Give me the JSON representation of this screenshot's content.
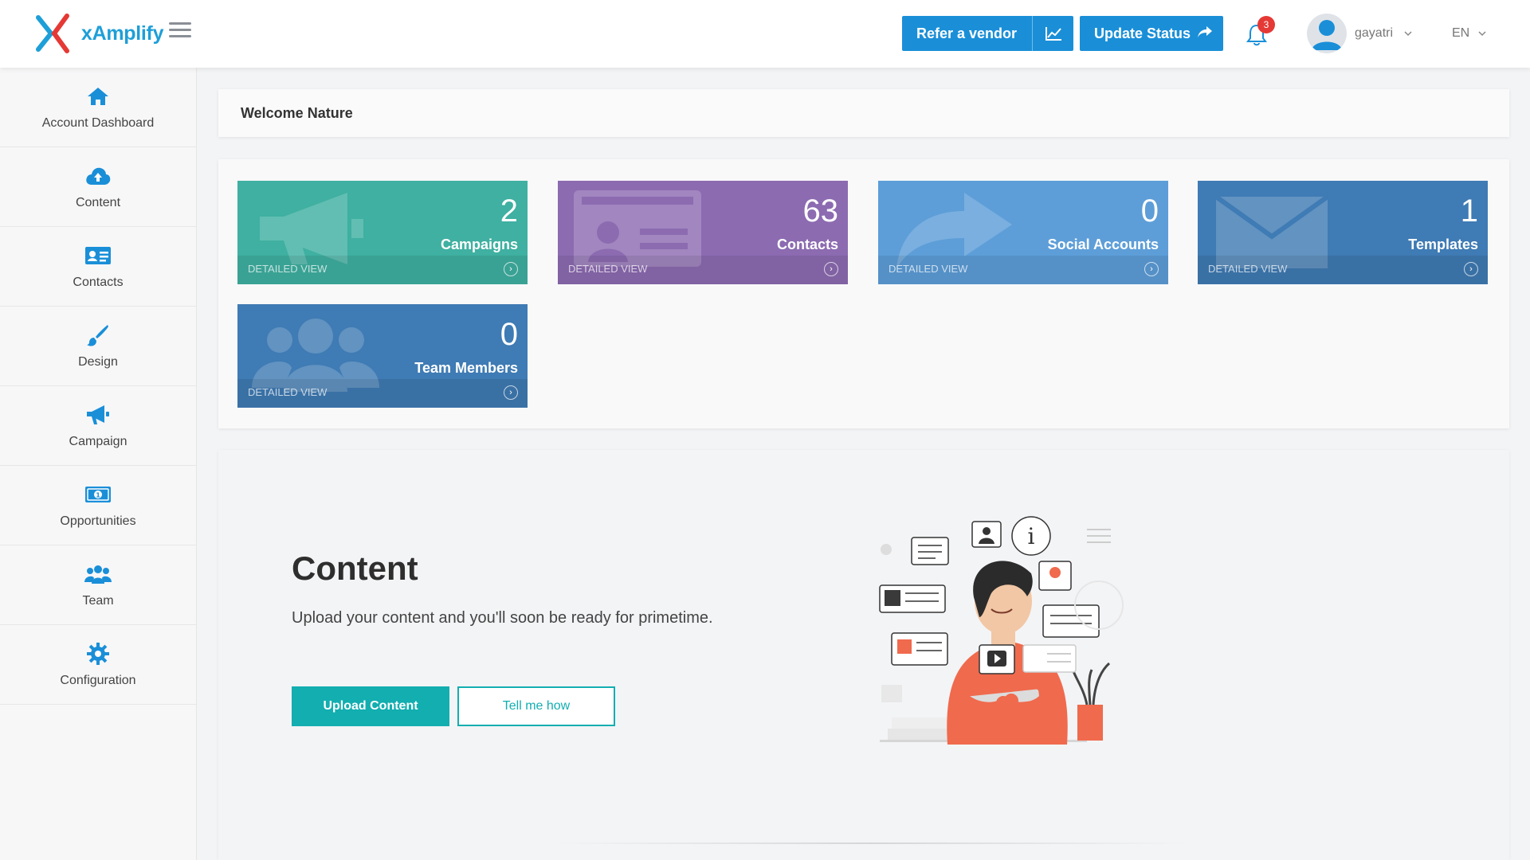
{
  "app": {
    "logo_text": "xAmplify"
  },
  "header": {
    "refer_label": "Refer a vendor",
    "update_label": "Update Status",
    "notification_count": "3",
    "username": "gayatri",
    "language": "EN"
  },
  "sidebar": {
    "items": [
      {
        "label": "Account Dashboard",
        "icon": "home-icon"
      },
      {
        "label": "Content",
        "icon": "cloud-upload-icon"
      },
      {
        "label": "Contacts",
        "icon": "contact-card-icon"
      },
      {
        "label": "Design",
        "icon": "paint-brush-icon"
      },
      {
        "label": "Campaign",
        "icon": "megaphone-icon"
      },
      {
        "label": "Opportunities",
        "icon": "money-icon"
      },
      {
        "label": "Team",
        "icon": "users-icon"
      },
      {
        "label": "Configuration",
        "icon": "gear-icon"
      }
    ]
  },
  "welcome": {
    "text": "Welcome Nature"
  },
  "cards": [
    {
      "value": "2",
      "label": "Campaigns",
      "footer": "DETAILED VIEW",
      "color": "#3fb0a1",
      "icon": "megaphone-icon"
    },
    {
      "value": "63",
      "label": "Contacts",
      "footer": "DETAILED VIEW",
      "color": "#8c6bb1",
      "icon": "id-card-icon"
    },
    {
      "value": "0",
      "label": "Social Accounts",
      "footer": "DETAILED VIEW",
      "color": "#5d9ed8",
      "icon": "share-arrow-icon"
    },
    {
      "value": "1",
      "label": "Templates",
      "footer": "DETAILED VIEW",
      "color": "#3f7bb4",
      "icon": "envelope-icon"
    },
    {
      "value": "0",
      "label": "Team Members",
      "footer": "DETAILED VIEW",
      "color": "#3f7bb4",
      "icon": "users-icon"
    }
  ],
  "content_section": {
    "title": "Content",
    "description": "Upload your content and you'll soon be ready for primetime.",
    "primary_button": "Upload Content",
    "secondary_button": "Tell me how"
  },
  "colors": {
    "brand_blue": "#1a8fd8",
    "teal": "#12aeb0",
    "badge_red": "#e53935"
  }
}
